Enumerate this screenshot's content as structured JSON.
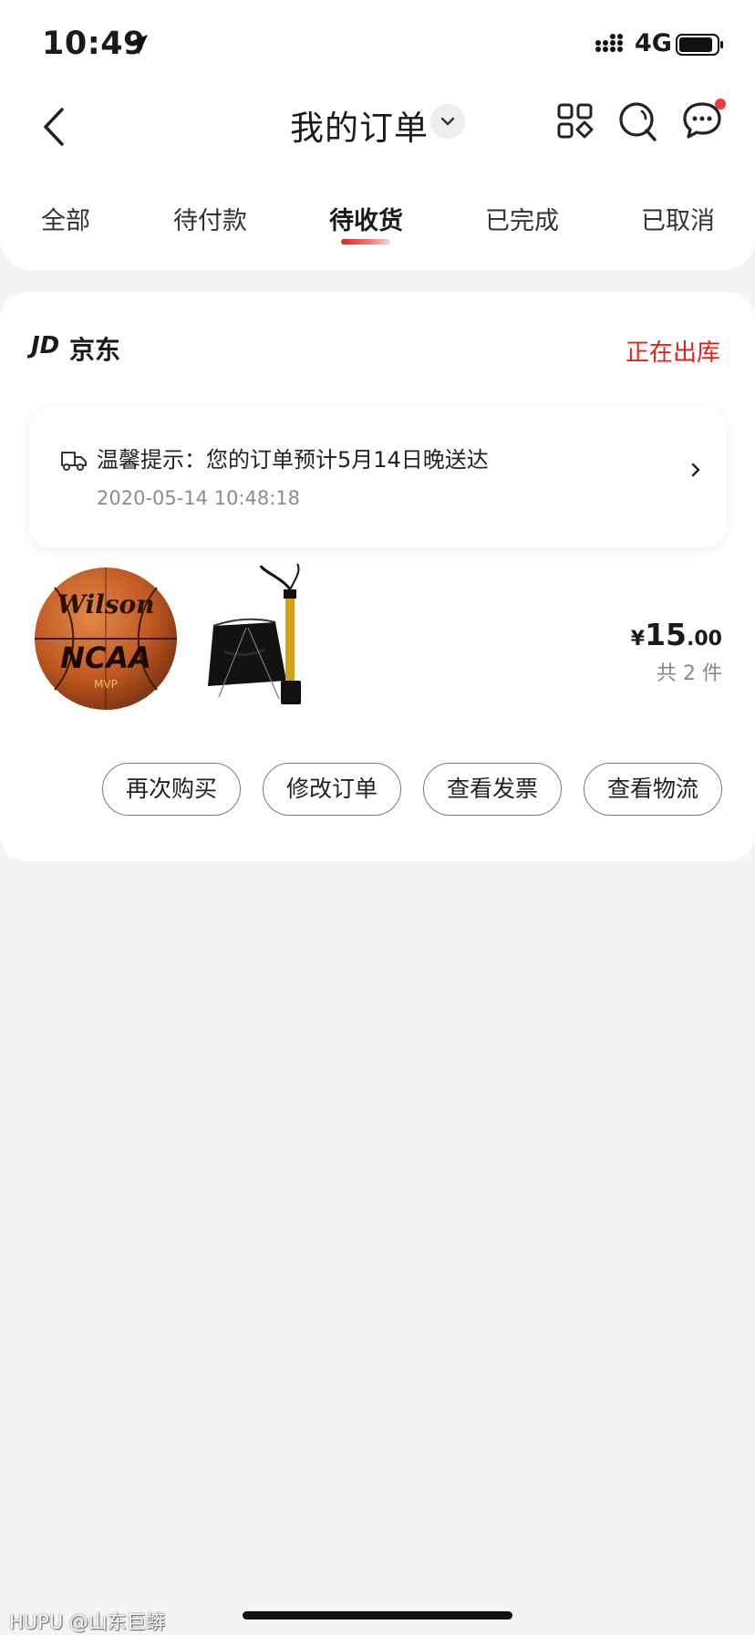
{
  "status_bar": {
    "time": "10:49",
    "network": "4G",
    "icons": [
      "location-arrow-icon",
      "signal-icon",
      "battery-icon"
    ]
  },
  "nav": {
    "title": "我的订单",
    "icons": [
      "back-icon",
      "chevron-down-icon",
      "apps-grid-icon",
      "search-icon",
      "message-icon"
    ]
  },
  "tabs": [
    {
      "label": "全部",
      "active": false
    },
    {
      "label": "待付款",
      "active": false
    },
    {
      "label": "待收货",
      "active": true
    },
    {
      "label": "已完成",
      "active": false
    },
    {
      "label": "已取消",
      "active": false
    }
  ],
  "order": {
    "shop_logo": "JD",
    "shop_name": "京东",
    "status": "正在出库",
    "notice": {
      "text": "温馨提示：您的订单预计5月14日晚送达",
      "time": "2020-05-14 10:48:18"
    },
    "products": [
      {
        "name": "basketball",
        "icon": "basketball-image",
        "text": [
          "Wilson",
          "NCAA",
          "MVP"
        ]
      },
      {
        "name": "bag-and-pump",
        "icon": "bag-pump-image"
      }
    ],
    "price": {
      "currency": "¥",
      "integer": "15",
      "decimal": ".00"
    },
    "item_count": "共 2 件",
    "actions": [
      "再次购买",
      "修改订单",
      "查看发票",
      "查看物流"
    ]
  },
  "watermark": "HUPU @山东巨蟒",
  "colors": {
    "accent": "#e2231a",
    "background": "#f4f4f4",
    "card": "#ffffff"
  }
}
